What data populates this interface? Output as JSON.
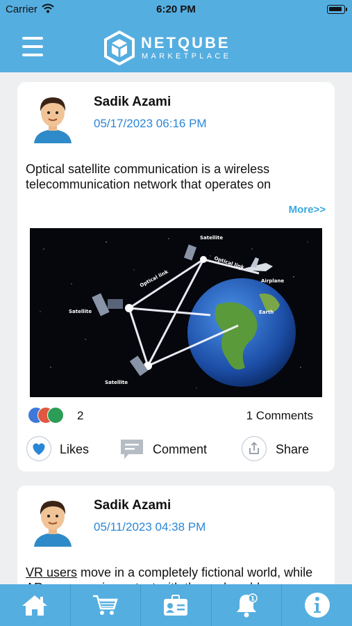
{
  "status_bar": {
    "carrier": "Carrier",
    "time": "6:20 PM"
  },
  "header": {
    "brand_title": "NETQUBE",
    "brand_subtitle": "MARKETPLACE"
  },
  "posts": [
    {
      "author": "Sadik Azami",
      "date": "05/17/2023 06:16 PM",
      "text": "Optical satellite communication is a wireless telecommunication network that operates on",
      "more_label": "More>>",
      "image_labels": [
        "Satellite",
        "Optical link",
        "Optical link",
        "Airplane",
        "Satellite",
        "Earth",
        "Satellite"
      ],
      "reaction_count": "2",
      "comments_label": "1 Comments",
      "actions": {
        "likes": "Likes",
        "comment": "Comment",
        "share": "Share"
      }
    },
    {
      "author": "Sadik Azami",
      "date": "05/11/2023 04:38 PM",
      "text_link": "VR users",
      "text_rest": " move in a completely fictional world, while AR users are in contact with the real world"
    }
  ],
  "tab_bar": [
    {
      "icon": "home-icon"
    },
    {
      "icon": "cart-icon"
    },
    {
      "icon": "id-card-icon"
    },
    {
      "icon": "bell-icon",
      "badge": "1"
    },
    {
      "icon": "info-icon"
    }
  ],
  "colors": {
    "brand": "#55aee0",
    "date": "#2a86d6",
    "more": "#3aa8e0",
    "background": "#eeeff1"
  }
}
